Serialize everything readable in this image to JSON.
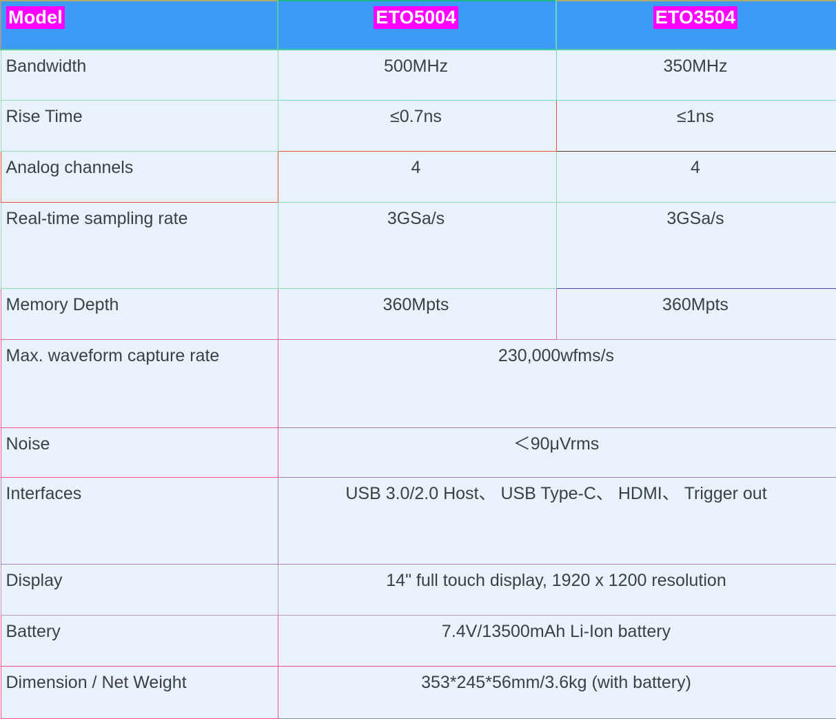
{
  "table": {
    "columns": [
      {
        "key": "model",
        "label": "Model",
        "highlight": true
      },
      {
        "key": "eto5004",
        "label": "ETO5004",
        "highlight": true
      },
      {
        "key": "eto3504",
        "label": "ETO3504",
        "highlight": true
      }
    ],
    "rows": [
      {
        "name": "Bandwidth",
        "eto5004": "500MHz",
        "eto3504": "350MHz",
        "merged": false
      },
      {
        "name": "Rise Time",
        "eto5004": "≤0.7ns",
        "eto3504": "≤1ns",
        "merged": false
      },
      {
        "name": "Analog channels",
        "eto5004": "4",
        "eto3504": "4",
        "merged": false
      },
      {
        "name": "Real-time sampling rate",
        "eto5004": "3GSa/s",
        "eto3504": "3GSa/s",
        "merged": false
      },
      {
        "name": "Memory Depth",
        "eto5004": "360Mpts",
        "eto3504": "360Mpts",
        "merged": false
      },
      {
        "name": "Max. waveform capture rate",
        "value": "230,000wfms/s",
        "merged": true
      },
      {
        "name": "Noise",
        "value": "＜90μVrms",
        "merged": true
      },
      {
        "name": "Interfaces",
        "value": "USB 3.0/2.0 Host、 USB Type-C、 HDMI、 Trigger out",
        "merged": true
      },
      {
        "name": "Display",
        "value": "14\" full touch display, 1920 x 1200 resolution",
        "merged": true
      },
      {
        "name": "Battery",
        "value": "7.4V/13500mAh Li-Ion battery",
        "merged": true
      },
      {
        "name": "Dimension / Net Weight",
        "value": "353*245*56mm/3.6kg (with battery)",
        "merged": true
      }
    ]
  },
  "colors": {
    "header_background": "#3d9bf8",
    "highlight_background": "#ff00ff",
    "highlight_text": "#ffffff",
    "cell_background": "#e9f1fb",
    "cell_text": "#3c4043"
  }
}
